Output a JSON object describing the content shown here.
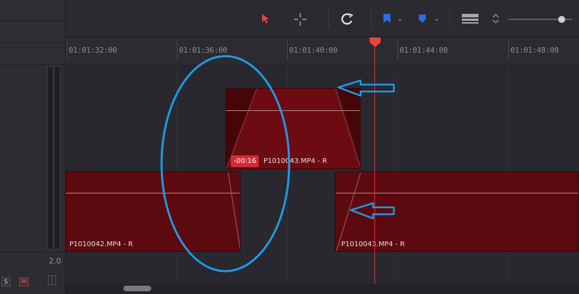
{
  "left_panel": {
    "volume_readout": "2.0",
    "solo_label": "S",
    "mute_label": "M"
  },
  "toolbar": {
    "icons": [
      "pointer-icon",
      "crosshair-icon",
      "snapping-icon",
      "flag-icon",
      "marker-icon",
      "clip-view-icon",
      "zoom-updown-icon",
      "zoom-slider"
    ],
    "accent_color": "#e8463c",
    "marker_color": "#2a6de8"
  },
  "ruler": {
    "timecodes": [
      "01:01:32:00",
      "01:01:36:00",
      "01:01:40:00",
      "01:01:44:00",
      "01:01:48:00"
    ]
  },
  "clips": {
    "top": {
      "name": "P1010043.MP4 - R",
      "offset_badge": "-00:16"
    },
    "left": {
      "name": "P1010042.MP4 - R"
    },
    "right": {
      "name": "P1010043.MP4 - R"
    }
  },
  "colors": {
    "clip_fill": "#5c0a0f",
    "playhead": "#d0353a",
    "annotation": "#1f9be6"
  }
}
